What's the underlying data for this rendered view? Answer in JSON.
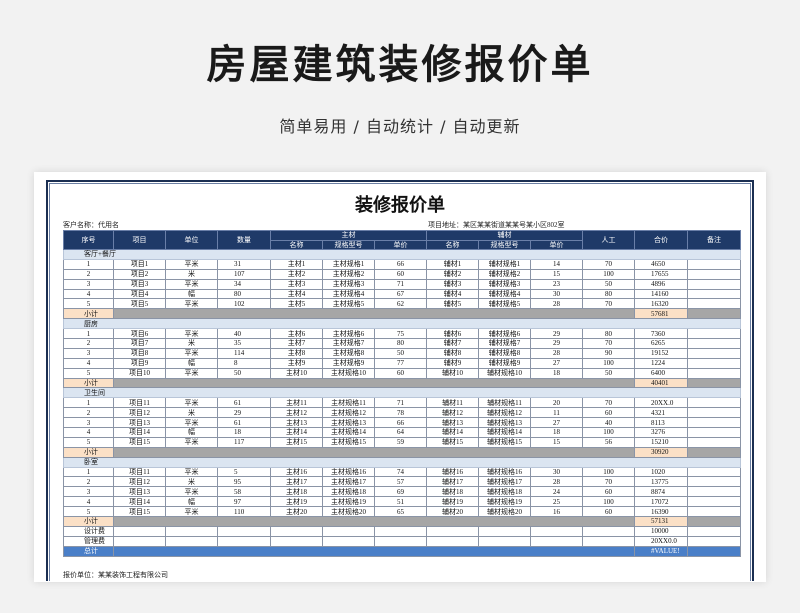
{
  "page": {
    "title": "房屋建筑装修报价单",
    "subtitle": "简单易用 / 自动统计 / 自动更新"
  },
  "sheet": {
    "title": "装修报价单",
    "client": "客户名称：代用名",
    "address": "项目地址：某区某某街道某某号某小区802室",
    "footer": "报价单位：某某装饰工程有限公司"
  },
  "headers": {
    "no": "序号",
    "item": "项目",
    "unit": "单位",
    "qty": "数量",
    "main": "主材",
    "aux": "辅材",
    "name": "名称",
    "spec": "规格型号",
    "price": "单价",
    "labor": "人工",
    "total": "合价",
    "note": "备注"
  },
  "sections": [
    {
      "name": "客厅+餐厅",
      "subtotal_label": "小计",
      "subtotal": "57681",
      "rows": [
        {
          "no": "1",
          "item": "项目1",
          "unit": "平米",
          "qty": "31",
          "m_name": "主材1",
          "m_spec": "主材规格1",
          "m_price": "66",
          "a_name": "辅材1",
          "a_spec": "辅材规格1",
          "a_price": "14",
          "labor": "70",
          "total": "4650",
          "note": ""
        },
        {
          "no": "2",
          "item": "项目2",
          "unit": "米",
          "qty": "107",
          "m_name": "主材2",
          "m_spec": "主材规格2",
          "m_price": "60",
          "a_name": "辅材2",
          "a_spec": "辅材规格2",
          "a_price": "15",
          "labor": "100",
          "total": "17655",
          "note": ""
        },
        {
          "no": "3",
          "item": "项目3",
          "unit": "平米",
          "qty": "34",
          "m_name": "主材3",
          "m_spec": "主材规格3",
          "m_price": "71",
          "a_name": "辅材3",
          "a_spec": "辅材规格3",
          "a_price": "23",
          "labor": "50",
          "total": "4896",
          "note": ""
        },
        {
          "no": "4",
          "item": "项目4",
          "unit": "幅",
          "qty": "80",
          "m_name": "主材4",
          "m_spec": "主材规格4",
          "m_price": "67",
          "a_name": "辅材4",
          "a_spec": "辅材规格4",
          "a_price": "30",
          "labor": "80",
          "total": "14160",
          "note": ""
        },
        {
          "no": "5",
          "item": "项目5",
          "unit": "平米",
          "qty": "102",
          "m_name": "主材5",
          "m_spec": "主材规格5",
          "m_price": "62",
          "a_name": "辅材5",
          "a_spec": "辅材规格5",
          "a_price": "28",
          "labor": "70",
          "total": "16320",
          "note": ""
        }
      ]
    },
    {
      "name": "厨房",
      "subtotal_label": "小计",
      "subtotal": "40401",
      "rows": [
        {
          "no": "1",
          "item": "项目6",
          "unit": "平米",
          "qty": "40",
          "m_name": "主材6",
          "m_spec": "主材规格6",
          "m_price": "75",
          "a_name": "辅材6",
          "a_spec": "辅材规格6",
          "a_price": "29",
          "labor": "80",
          "total": "7360",
          "note": ""
        },
        {
          "no": "2",
          "item": "项目7",
          "unit": "米",
          "qty": "35",
          "m_name": "主材7",
          "m_spec": "主材规格7",
          "m_price": "80",
          "a_name": "辅材7",
          "a_spec": "辅材规格7",
          "a_price": "29",
          "labor": "70",
          "total": "6265",
          "note": ""
        },
        {
          "no": "3",
          "item": "项目8",
          "unit": "平米",
          "qty": "114",
          "m_name": "主材8",
          "m_spec": "主材规格8",
          "m_price": "50",
          "a_name": "辅材8",
          "a_spec": "辅材规格8",
          "a_price": "28",
          "labor": "90",
          "total": "19152",
          "note": ""
        },
        {
          "no": "4",
          "item": "项目9",
          "unit": "幅",
          "qty": "8",
          "m_name": "主材9",
          "m_spec": "主材规格9",
          "m_price": "77",
          "a_name": "辅材9",
          "a_spec": "辅材规格9",
          "a_price": "27",
          "labor": "100",
          "total": "1224",
          "note": ""
        },
        {
          "no": "5",
          "item": "项目10",
          "unit": "平米",
          "qty": "50",
          "m_name": "主材10",
          "m_spec": "主材规格10",
          "m_price": "60",
          "a_name": "辅材10",
          "a_spec": "辅材规格10",
          "a_price": "18",
          "labor": "50",
          "total": "6400",
          "note": ""
        }
      ]
    },
    {
      "name": "卫生间",
      "subtotal_label": "小计",
      "subtotal": "30920",
      "rows": [
        {
          "no": "1",
          "item": "项目11",
          "unit": "平米",
          "qty": "61",
          "m_name": "主材11",
          "m_spec": "主材规格11",
          "m_price": "71",
          "a_name": "辅材11",
          "a_spec": "辅材规格11",
          "a_price": "20",
          "labor": "70",
          "total": "20XX.0",
          "note": ""
        },
        {
          "no": "2",
          "item": "项目12",
          "unit": "米",
          "qty": "29",
          "m_name": "主材12",
          "m_spec": "主材规格12",
          "m_price": "78",
          "a_name": "辅材12",
          "a_spec": "辅材规格12",
          "a_price": "11",
          "labor": "60",
          "total": "4321",
          "note": ""
        },
        {
          "no": "3",
          "item": "项目13",
          "unit": "平米",
          "qty": "61",
          "m_name": "主材13",
          "m_spec": "主材规格13",
          "m_price": "66",
          "a_name": "辅材13",
          "a_spec": "辅材规格13",
          "a_price": "27",
          "labor": "40",
          "total": "8113",
          "note": ""
        },
        {
          "no": "4",
          "item": "项目14",
          "unit": "幅",
          "qty": "18",
          "m_name": "主材14",
          "m_spec": "主材规格14",
          "m_price": "64",
          "a_name": "辅材14",
          "a_spec": "辅材规格14",
          "a_price": "18",
          "labor": "100",
          "total": "3276",
          "note": ""
        },
        {
          "no": "5",
          "item": "项目15",
          "unit": "平米",
          "qty": "117",
          "m_name": "主材15",
          "m_spec": "主材规格15",
          "m_price": "59",
          "a_name": "辅材15",
          "a_spec": "辅材规格15",
          "a_price": "15",
          "labor": "56",
          "total": "15210",
          "note": ""
        }
      ]
    },
    {
      "name": "卧室",
      "subtotal_label": "小计",
      "subtotal": "57131",
      "rows": [
        {
          "no": "1",
          "item": "项目11",
          "unit": "平米",
          "qty": "5",
          "m_name": "主材16",
          "m_spec": "主材规格16",
          "m_price": "74",
          "a_name": "辅材16",
          "a_spec": "辅材规格16",
          "a_price": "30",
          "labor": "100",
          "total": "1020",
          "note": ""
        },
        {
          "no": "2",
          "item": "项目12",
          "unit": "米",
          "qty": "95",
          "m_name": "主材17",
          "m_spec": "主材规格17",
          "m_price": "57",
          "a_name": "辅材17",
          "a_spec": "辅材规格17",
          "a_price": "28",
          "labor": "70",
          "total": "13775",
          "note": ""
        },
        {
          "no": "3",
          "item": "项目13",
          "unit": "平米",
          "qty": "58",
          "m_name": "主材18",
          "m_spec": "主材规格18",
          "m_price": "69",
          "a_name": "辅材18",
          "a_spec": "辅材规格18",
          "a_price": "24",
          "labor": "60",
          "total": "8874",
          "note": ""
        },
        {
          "no": "4",
          "item": "项目14",
          "unit": "幅",
          "qty": "97",
          "m_name": "主材19",
          "m_spec": "主材规格19",
          "m_price": "51",
          "a_name": "辅材19",
          "a_spec": "辅材规格19",
          "a_price": "25",
          "labor": "100",
          "total": "17072",
          "note": ""
        },
        {
          "no": "5",
          "item": "项目15",
          "unit": "平米",
          "qty": "110",
          "m_name": "主材20",
          "m_spec": "主材规格20",
          "m_price": "65",
          "a_name": "辅材20",
          "a_spec": "辅材规格20",
          "a_price": "16",
          "labor": "60",
          "total": "16390",
          "note": ""
        }
      ]
    }
  ],
  "fees": [
    {
      "label": "设计费",
      "value": "10000"
    },
    {
      "label": "管理费",
      "value": "20XX0.0"
    }
  ],
  "grand_total": {
    "label": "总计",
    "value": "#VALUE!"
  }
}
